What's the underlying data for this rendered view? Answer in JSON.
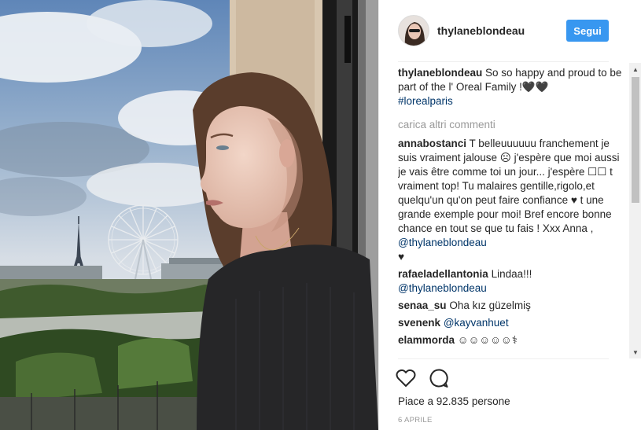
{
  "post": {
    "username": "thylaneblondeau",
    "follow_label": "Segui",
    "caption": {
      "username": "thylaneblondeau",
      "text": "So so happy and proud to be part of the l' Oreal Family !🖤🖤",
      "hashtag": "#lorealparis"
    },
    "load_more_label": "carica altri commenti",
    "comments": [
      {
        "username": "annabostanci",
        "text": "T belleuuuuuu franchement je suis vraiment jalouse ☹ j'espère que moi aussi je vais être comme toi un jour... j'espère ☐☐ t vraiment top! Tu malaires gentille,rigolo,et quelqu'un qu'on peut faire confiance ♥ t une grande exemple pour moi! Bref encore bonne chance en tout se que tu fais ! Xxx Anna ,",
        "mention": "@thylaneblondeau",
        "trailing": "♥"
      },
      {
        "username": "rafaeladellantonia",
        "text": "Lindaa!!!",
        "mention": "@thylaneblondeau",
        "trailing": ""
      },
      {
        "username": "senaa_su",
        "text": "Oha kız güzelmiş",
        "mention": "",
        "trailing": ""
      },
      {
        "username": "svenenk",
        "text": "",
        "mention": "@kayvanhuet",
        "trailing": ""
      },
      {
        "username": "elammorda",
        "text": "☺☺☺☺☺⚕",
        "mention": "",
        "trailing": ""
      }
    ],
    "likes_text": "Piace a 92.835 persone",
    "date_text": "6 APRILE"
  },
  "icons": {
    "like": "heart-icon",
    "comment": "comment-bubble-icon",
    "scroll_up": "scroll-up-arrow-icon",
    "scroll_down": "scroll-down-arrow-icon"
  },
  "colors": {
    "follow_button": "#3897f0",
    "link": "#003569",
    "muted": "#999999",
    "divider": "#efefef"
  }
}
